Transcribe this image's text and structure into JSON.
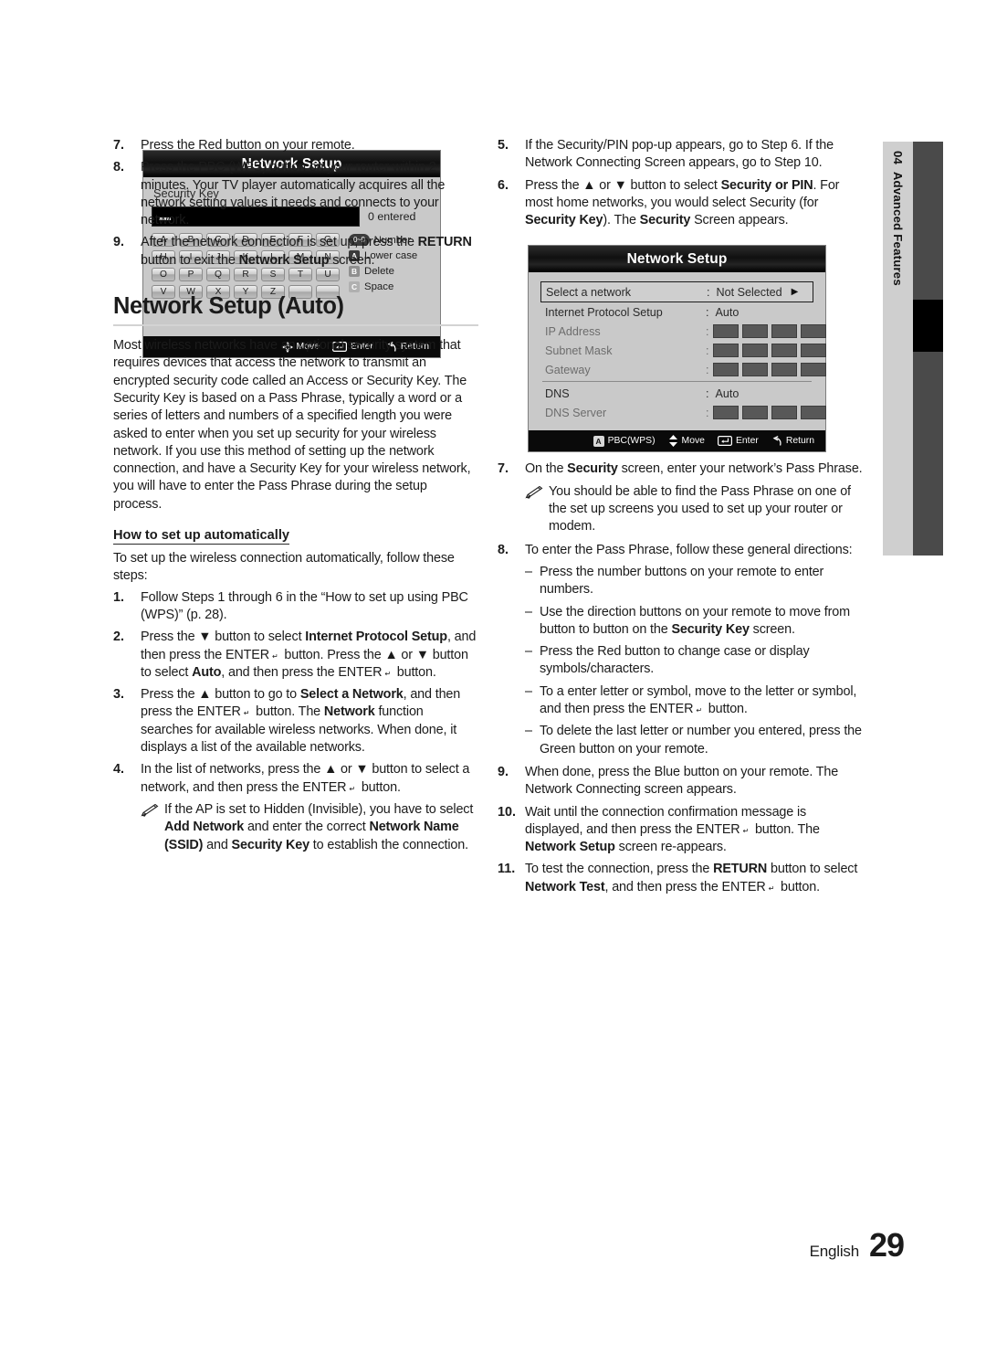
{
  "page": {
    "language_label": "English",
    "page_number": "29",
    "side_tab": {
      "chapter_number": "04",
      "chapter_title": "Advanced Features"
    }
  },
  "figure1": {
    "title": "Network Setup",
    "field_label": "Security Key",
    "entered_count": "0 entered",
    "keyboard_rows": [
      [
        "A",
        "B",
        "C",
        "D",
        "E",
        "F",
        "G"
      ],
      [
        "H",
        "I",
        "J",
        "K",
        "L",
        "M",
        "N"
      ],
      [
        "O",
        "P",
        "Q",
        "R",
        "S",
        "T",
        "U"
      ],
      [
        "V",
        "W",
        "X",
        "Y",
        "Z",
        "",
        ""
      ]
    ],
    "legend": [
      {
        "badge": "0~9",
        "badge_kind": "pill",
        "label": "Number"
      },
      {
        "badge": "A",
        "badge_kind": "a",
        "label": "Lower case"
      },
      {
        "badge": "B",
        "badge_kind": "b",
        "label": "Delete"
      },
      {
        "badge": "C",
        "badge_kind": "c",
        "label": "Space"
      }
    ],
    "footer": [
      {
        "icon": "dpad-move-icon",
        "label": "Move"
      },
      {
        "icon": "enter-key-icon",
        "label": "Enter"
      },
      {
        "icon": "return-arrow-icon",
        "label": "Return"
      }
    ]
  },
  "figure2": {
    "title": "Network Setup",
    "rows": [
      {
        "label": "Select a network",
        "value": "Not Selected",
        "state": "selected",
        "has_arrow": true
      },
      {
        "label": "Internet Protocol Setup",
        "value": "Auto",
        "state": "normal"
      },
      {
        "label": "IP Address",
        "value": "",
        "state": "dim",
        "boxes": 4
      },
      {
        "label": "Subnet Mask",
        "value": "",
        "state": "dim",
        "boxes": 4
      },
      {
        "label": "Gateway",
        "value": "",
        "state": "dim",
        "boxes": 4
      },
      {
        "separator": true
      },
      {
        "label": "DNS",
        "value": "Auto",
        "state": "normal"
      },
      {
        "label": "DNS Server",
        "value": "",
        "state": "dim",
        "boxes": 4
      }
    ],
    "footer": [
      {
        "icon": "red-a-button-icon",
        "badge": "A",
        "label": "PBC(WPS)"
      },
      {
        "icon": "updown-move-icon",
        "label": "Move"
      },
      {
        "icon": "enter-key-icon",
        "label": "Enter"
      },
      {
        "icon": "return-arrow-icon",
        "label": "Return"
      }
    ]
  },
  "left_column": {
    "steps_top": [
      {
        "num": "7.",
        "html": "Press the Red button on your remote."
      },
      {
        "num": "8.",
        "html": "Press the PBC (WPS) button on your router within 2 minutes. Your TV player automatically acquires all the network setting values it needs and connects to your network."
      },
      {
        "num": "9.",
        "html": "After the network connection is set up, press the <b>RETURN</b> button to exit the <b>Network Setup</b> screen."
      }
    ],
    "heading": "Network Setup (Auto)",
    "intro": "Most wireless networks have an optional security system that requires devices that access the network to transmit an encrypted security code called an Access or Security Key. The Security Key is based on a Pass Phrase, typically a word or a series of letters and numbers of a specified length you were asked to enter when you set up security for your wireless network.  If you use this method of setting up the network connection, and have a Security Key for your wireless network, you will have to enter the Pass Phrase during the setup process.",
    "subheading": "How to set up automatically",
    "sub_intro": "To set up the wireless connection automatically, follow these steps:",
    "steps": [
      {
        "num": "1.",
        "html": "Follow Steps 1 through 6 in the &ldquo;How to set up using PBC (WPS)&rdquo; (p. 28)."
      },
      {
        "num": "2.",
        "html": "Press the &#9660; button to select <b>Internet Protocol Setup</b>, and then press the ENTER<span class=\"ico-enter\">&#8629;</span> button. Press the &#9650; or &#9660; button to select <b>Auto</b>, and then press the ENTER<span class=\"ico-enter\">&#8629;</span> button."
      },
      {
        "num": "3.",
        "html": "Press the &#9650; button to go to <b>Select a Network</b>, and then press the ENTER<span class=\"ico-enter\">&#8629;</span> button. The <b>Network</b> function searches for available wireless networks. When done, it displays a list of the available networks."
      },
      {
        "num": "4.",
        "html": "In the list of networks, press the &#9650; or &#9660; button to select a network, and then press the ENTER<span class=\"ico-enter\">&#8629;</span> button."
      }
    ],
    "note": "If the AP is set to Hidden (Invisible), you have to select <b>Add Network</b> and enter the correct <b>Network Name (SSID)</b> and <b>Security Key</b> to establish the connection."
  },
  "right_column": {
    "steps_top": [
      {
        "num": "5.",
        "html": "If the Security/PIN pop-up appears, go to Step 6. If the Network Connecting Screen appears, go to Step 10."
      },
      {
        "num": "6.",
        "html": "Press the &#9650; or &#9660; button to select <b>Security or PIN</b>. For most home networks, you would select Security (for <b>Security Key</b>). The <b>Security</b> Screen appears."
      }
    ],
    "step7": {
      "num": "7.",
      "html": "On the <b>Security</b> screen, enter your network&rsquo;s Pass Phrase."
    },
    "note7": "You should be able to find the Pass Phrase on one of the set up screens you used to set up your router or modem.",
    "step8": {
      "num": "8.",
      "html": "To enter the Pass Phrase, follow these general directions:"
    },
    "dashes": [
      "Press the number buttons on your remote to enter numbers.",
      "Use the direction buttons on your remote to move from button to button on the <b>Security Key</b> screen.",
      "Press the Red button to change case or display symbols/characters.",
      "To a enter letter or symbol, move to the letter or symbol, and then press the ENTER<span class=\"ico-enter\">&#8629;</span> button.",
      "To delete the last letter or number you entered, press the Green button on your remote."
    ],
    "steps_bottom": [
      {
        "num": "9.",
        "html": "When done, press the Blue button on your remote. The Network Connecting screen appears."
      },
      {
        "num": "10.",
        "html": "Wait until the connection confirmation message is displayed, and then press the ENTER<span class=\"ico-enter\">&#8629;</span> button. The <b>Network Setup</b> screen re-appears."
      },
      {
        "num": "11.",
        "html": "To test the connection, press the <b>RETURN</b> button to select <b>Network Test</b>, and then press the ENTER<span class=\"ico-enter\">&#8629;</span> button."
      }
    ]
  }
}
